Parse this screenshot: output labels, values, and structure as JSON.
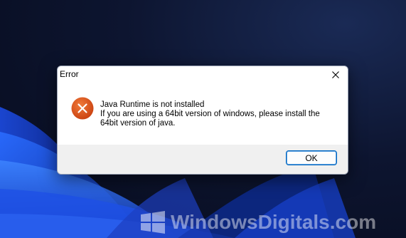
{
  "desktop": {
    "wallpaper": "windows-11-bloom",
    "accent_color": "#1f4fd6"
  },
  "dialog": {
    "title": "Error",
    "close_icon": "close-icon",
    "icon": "error-icon",
    "message_heading": "Java Runtime is not installed",
    "message_line_1": "If you are using a 64bit version of windows, please install the",
    "message_line_2": "64bit version of java.",
    "ok_label": "OK",
    "colors": {
      "error_icon": "#d94c16",
      "ok_border": "#0067c0",
      "footer_bg": "#f0f0f0"
    }
  },
  "watermark": {
    "text": "WindowsDigitals.com",
    "logo_icon": "windows-logo-icon"
  }
}
